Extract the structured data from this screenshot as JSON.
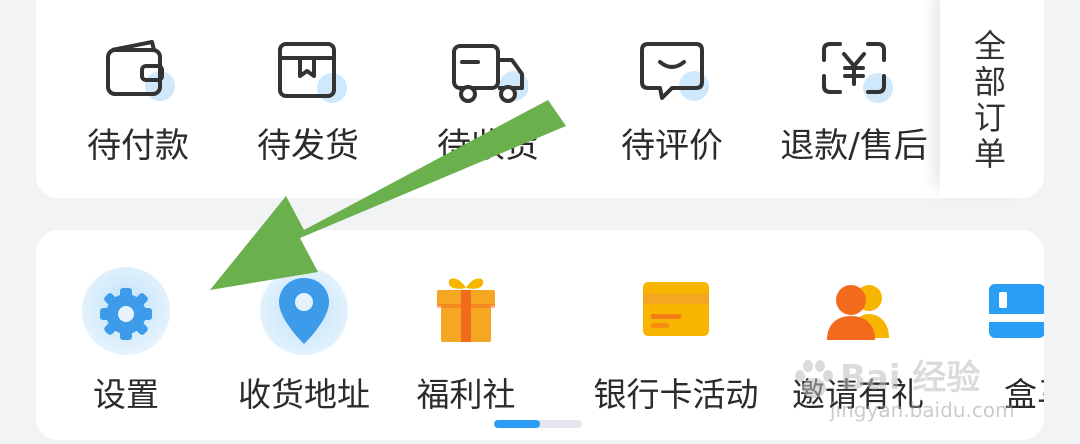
{
  "orders": {
    "items": [
      {
        "label": "待付款",
        "icon": "wallet-icon"
      },
      {
        "label": "待发货",
        "icon": "package-box-icon"
      },
      {
        "label": "待收货",
        "icon": "delivery-truck-icon"
      },
      {
        "label": "待评价",
        "icon": "chat-review-icon"
      },
      {
        "label": "退款/售后",
        "icon": "yuan-refund-icon"
      }
    ],
    "all_orders_label": "全部订单"
  },
  "services": {
    "items": [
      {
        "label": "设置",
        "icon": "gear-icon"
      },
      {
        "label": "收货地址",
        "icon": "location-pin-icon"
      },
      {
        "label": "福利社",
        "icon": "gift-icon"
      },
      {
        "label": "银行卡活动",
        "icon": "bank-card-icon"
      },
      {
        "label": "邀请有礼",
        "icon": "invite-users-icon"
      },
      {
        "label": "盒马",
        "icon": "hema-store-icon"
      }
    ],
    "pager": {
      "pages": 2,
      "current": 1
    }
  },
  "watermark": {
    "brand": "Bai 经验",
    "url": "jingyan.baidu.com"
  },
  "colors": {
    "arrow": "#6ab04c",
    "accent_blue": "#2a9df4",
    "gift_orange": "#f5a623",
    "card_yellow": "#f7b500",
    "invite_orange": "#f26b1d"
  }
}
